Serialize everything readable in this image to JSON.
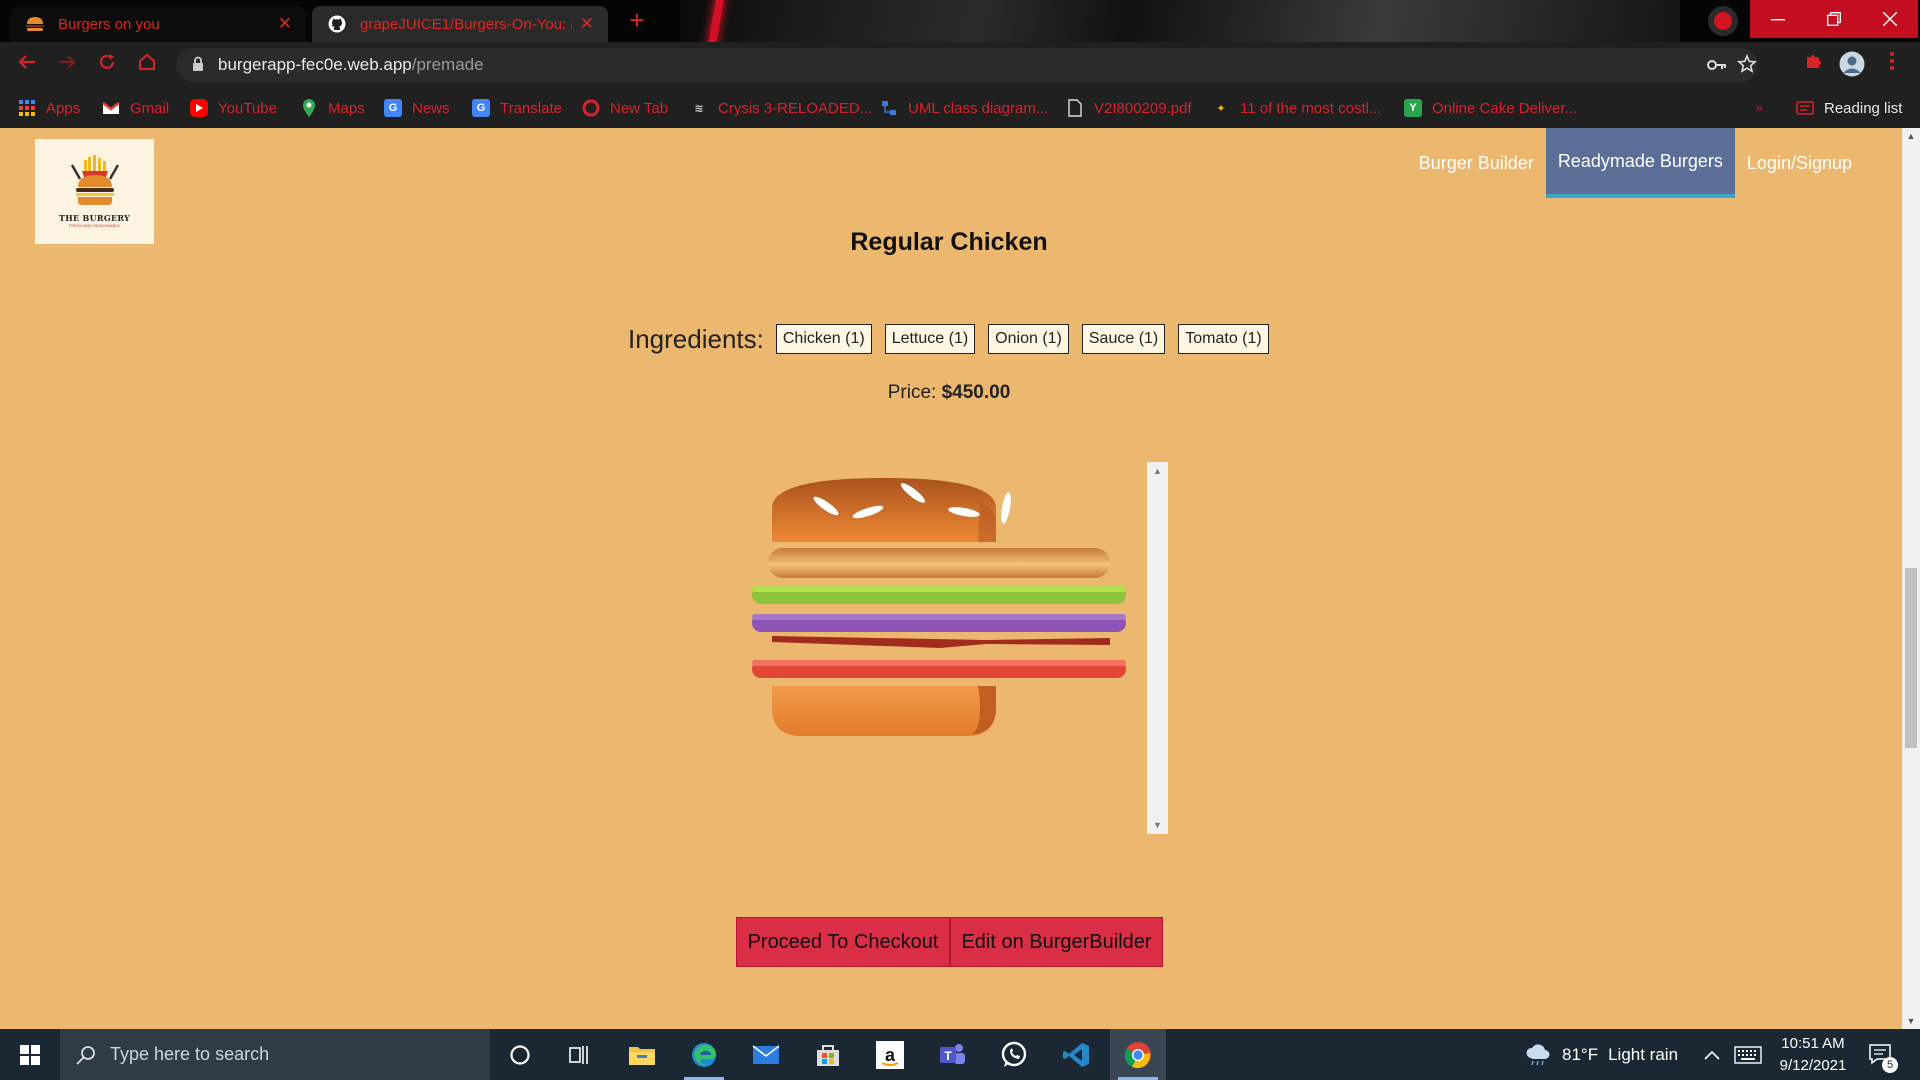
{
  "browser": {
    "tabs": [
      {
        "title": "Burgers on you",
        "close": "✕"
      },
      {
        "title": "grapeJUICE1/Burgers-On-You: a",
        "close": "✕"
      }
    ],
    "new_tab": "+",
    "url_host": "burgerapp-fec0e.web.app",
    "url_path": "/premade",
    "bookmarks": [
      {
        "label": "Apps",
        "icon": "apps-grid-icon"
      },
      {
        "label": "Gmail",
        "icon": "gmail-icon"
      },
      {
        "label": "YouTube",
        "icon": "youtube-icon"
      },
      {
        "label": "Maps",
        "icon": "maps-icon"
      },
      {
        "label": "News",
        "icon": "news-icon"
      },
      {
        "label": "Translate",
        "icon": "translate-icon"
      },
      {
        "label": "New Tab",
        "icon": "opera-icon"
      },
      {
        "label": "Crysis 3-RELOADED...",
        "icon": "skidrow-icon"
      },
      {
        "label": "UML class diagram...",
        "icon": "uml-icon"
      },
      {
        "label": "V2I800209.pdf",
        "icon": "pdf-icon"
      },
      {
        "label": "11 of the most costl...",
        "icon": "article-icon"
      },
      {
        "label": "Online Cake Deliver...",
        "icon": "cake-icon"
      }
    ],
    "reading_list": "Reading list",
    "accent": "#d6232a"
  },
  "app": {
    "logo_text": "THE BURGERY",
    "logo_sub": "FRESH AND REASONABLE",
    "nav": [
      {
        "label": "Burger Builder",
        "active": false
      },
      {
        "label": "Readymade Burgers",
        "active": true
      },
      {
        "label": "Login/Signup",
        "active": false
      }
    ],
    "burger_name": "Regular Chicken",
    "ingredients_label": "Ingredients:",
    "ingredients": [
      "Chicken (1)",
      "Lettuce (1)",
      "Onion (1)",
      "Sauce (1)",
      "Tomato (1)"
    ],
    "price_label": "Price:",
    "price_value": "$450.00",
    "checkout_label": "Proceed To Checkout",
    "edit_label": "Edit on BurgerBuilder",
    "page_bg": "#ecb76e",
    "button_color": "#d92e46"
  },
  "taskbar": {
    "search_placeholder": "Type here to search",
    "weather_temp": "81°F",
    "weather_text": "Light rain",
    "time": "10:51 AM",
    "date": "9/12/2021",
    "notifications": "5"
  }
}
